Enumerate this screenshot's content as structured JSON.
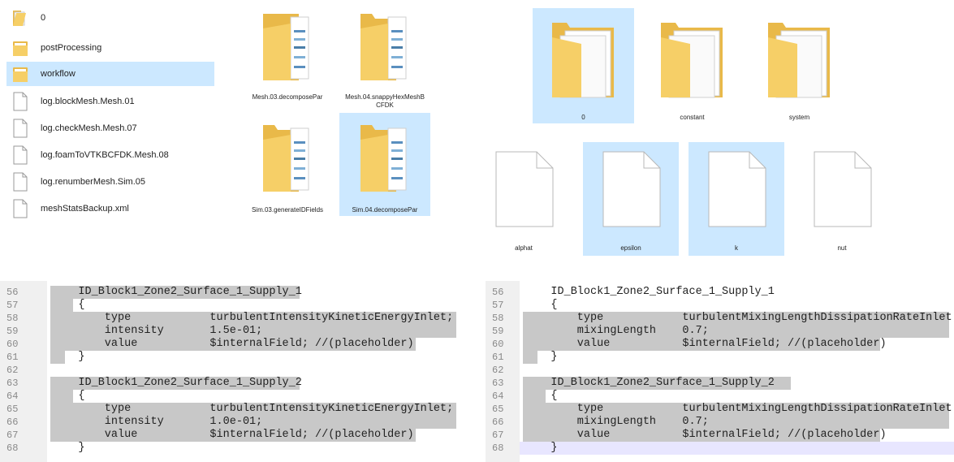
{
  "list": [
    {
      "name": "0",
      "kind": "folder-open",
      "selected": false
    },
    {
      "name": "postProcessing",
      "kind": "folder",
      "selected": false
    },
    {
      "name": "workflow",
      "kind": "folder",
      "selected": true
    },
    {
      "name": "log.blockMesh.Mesh.01",
      "kind": "file",
      "selected": false
    },
    {
      "name": "log.checkMesh.Mesh.07",
      "kind": "file",
      "selected": false
    },
    {
      "name": "log.foamToVTKBCFDK.Mesh.08",
      "kind": "file",
      "selected": false
    },
    {
      "name": "log.renumberMesh.Sim.05",
      "kind": "file",
      "selected": false
    },
    {
      "name": "meshStatsBackup.xml",
      "kind": "file",
      "selected": false
    }
  ],
  "middle_folders": [
    {
      "name": "Mesh.03.decomposePar",
      "selected": false
    },
    {
      "name": "Mesh.04.snappyHexMeshBCFDK",
      "name_line1": "Mesh.04.snappyHexMeshB",
      "name_line2": "CFDK",
      "selected": false
    },
    {
      "name": "Sim.03.generateIDFields",
      "selected": false
    },
    {
      "name": "Sim.04.decomposePar",
      "selected": true
    }
  ],
  "right_folders": [
    {
      "name": "0",
      "selected": true
    },
    {
      "name": "constant",
      "selected": false
    },
    {
      "name": "system",
      "selected": false
    }
  ],
  "right_files": [
    {
      "name": "alphat",
      "selected": false
    },
    {
      "name": "epsilon",
      "selected": true
    },
    {
      "name": "k",
      "selected": true
    },
    {
      "name": "nut",
      "selected": false
    }
  ],
  "code_left": [
    {
      "n": "56",
      "t": "    ID_Block1_Zone2_Surface_1_Supply_1"
    },
    {
      "n": "57",
      "t": "    {"
    },
    {
      "n": "58",
      "t": "        type            turbulentIntensityKineticEnergyInlet;"
    },
    {
      "n": "59",
      "t": "        intensity       1.5e-01;"
    },
    {
      "n": "60",
      "t": "        value           $internalField; //(placeholder)"
    },
    {
      "n": "61",
      "t": "    }"
    },
    {
      "n": "62",
      "t": ""
    },
    {
      "n": "63",
      "t": "    ID_Block1_Zone2_Surface_1_Supply_2"
    },
    {
      "n": "64",
      "t": "    {"
    },
    {
      "n": "65",
      "t": "        type            turbulentIntensityKineticEnergyInlet;"
    },
    {
      "n": "66",
      "t": "        intensity       1.0e-01;"
    },
    {
      "n": "67",
      "t": "        value           $internalField; //(placeholder)"
    },
    {
      "n": "68",
      "t": "    }"
    }
  ],
  "code_right": [
    {
      "n": "56",
      "t": "    ID_Block1_Zone2_Surface_1_Supply_1"
    },
    {
      "n": "57",
      "t": "    {"
    },
    {
      "n": "58",
      "t": "        type            turbulentMixingLengthDissipationRateInlet;"
    },
    {
      "n": "59",
      "t": "        mixingLength    0.7;"
    },
    {
      "n": "60",
      "t": "        value           $internalField; //(placeholder)"
    },
    {
      "n": "61",
      "t": "    }"
    },
    {
      "n": "62",
      "t": ""
    },
    {
      "n": "63",
      "t": "    ID_Block1_Zone2_Surface_1_Supply_2"
    },
    {
      "n": "64",
      "t": "    {"
    },
    {
      "n": "65",
      "t": "        type            turbulentMixingLengthDissipationRateInlet;"
    },
    {
      "n": "66",
      "t": "        mixingLength    0.7;"
    },
    {
      "n": "67",
      "t": "        value           $internalField; //(placeholder)"
    },
    {
      "n": "68",
      "t": "    }"
    }
  ],
  "colors": {
    "selection": "#cce8ff",
    "folder": "#f6cf67",
    "code_highlight": "#c8c8c8",
    "cursor_line": "#e8e6ff"
  }
}
